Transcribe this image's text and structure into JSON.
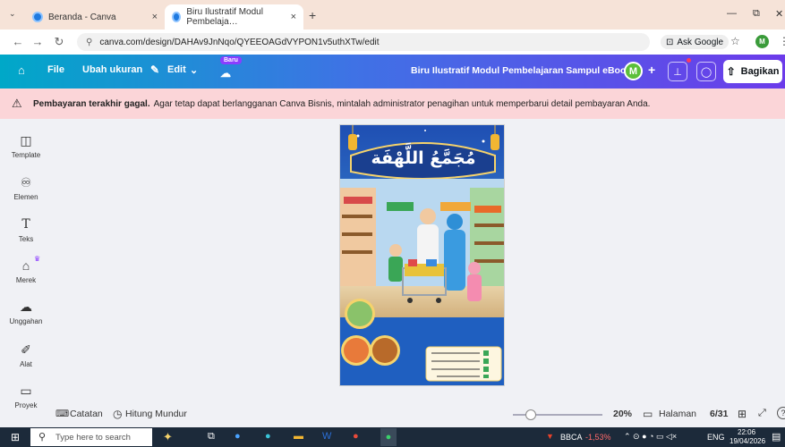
{
  "tabs": [
    {
      "title": "Beranda - Canva",
      "close": "×"
    },
    {
      "title": "Biru Ilustratif Modul Pembelaja…",
      "close": "×"
    }
  ],
  "new_tab": "+",
  "window_controls": {
    "minimize": "—",
    "restore": "⧉",
    "close": "✕"
  },
  "address": {
    "url": "canva.com/design/DAHAv9JnNqo/QYEEOAGdVYPON1v5uthXTw/edit",
    "ask_google": "Ask Google",
    "profile": "M"
  },
  "canva_bar": {
    "file": "File",
    "resize": "Ubah ukuran",
    "edit": "Edit",
    "new_badge": "Baru",
    "doc_title": "Biru Ilustratif Modul Pembelajaran Sampul eBook",
    "avatar": "M",
    "share": "Bagikan"
  },
  "banner": {
    "bold": "Pembayaran terakhir gagal.",
    "text": "Agar tetap dapat berlangganan Canva Bisnis, mintalah administrator penagihan untuk memperbarui detail pembayaran Anda."
  },
  "rail": [
    "Template",
    "Elemen",
    "Teks",
    "Merek",
    "Unggahan",
    "Alat",
    "Proyek"
  ],
  "poster": {
    "title_ar": "مُجَمَّعُ اللَّهْفَة"
  },
  "status": {
    "notes": "Catatan",
    "timer": "Hitung Mundur",
    "zoom": "20%",
    "pages": "Halaman",
    "page_count": "6/31"
  },
  "zoom_value": 20,
  "taskbar": {
    "search": "Type here to search",
    "stock": "BBCA",
    "stock_change": "-1,53%",
    "lang": "ENG",
    "time": "22:06",
    "date": "19/04/2026"
  }
}
